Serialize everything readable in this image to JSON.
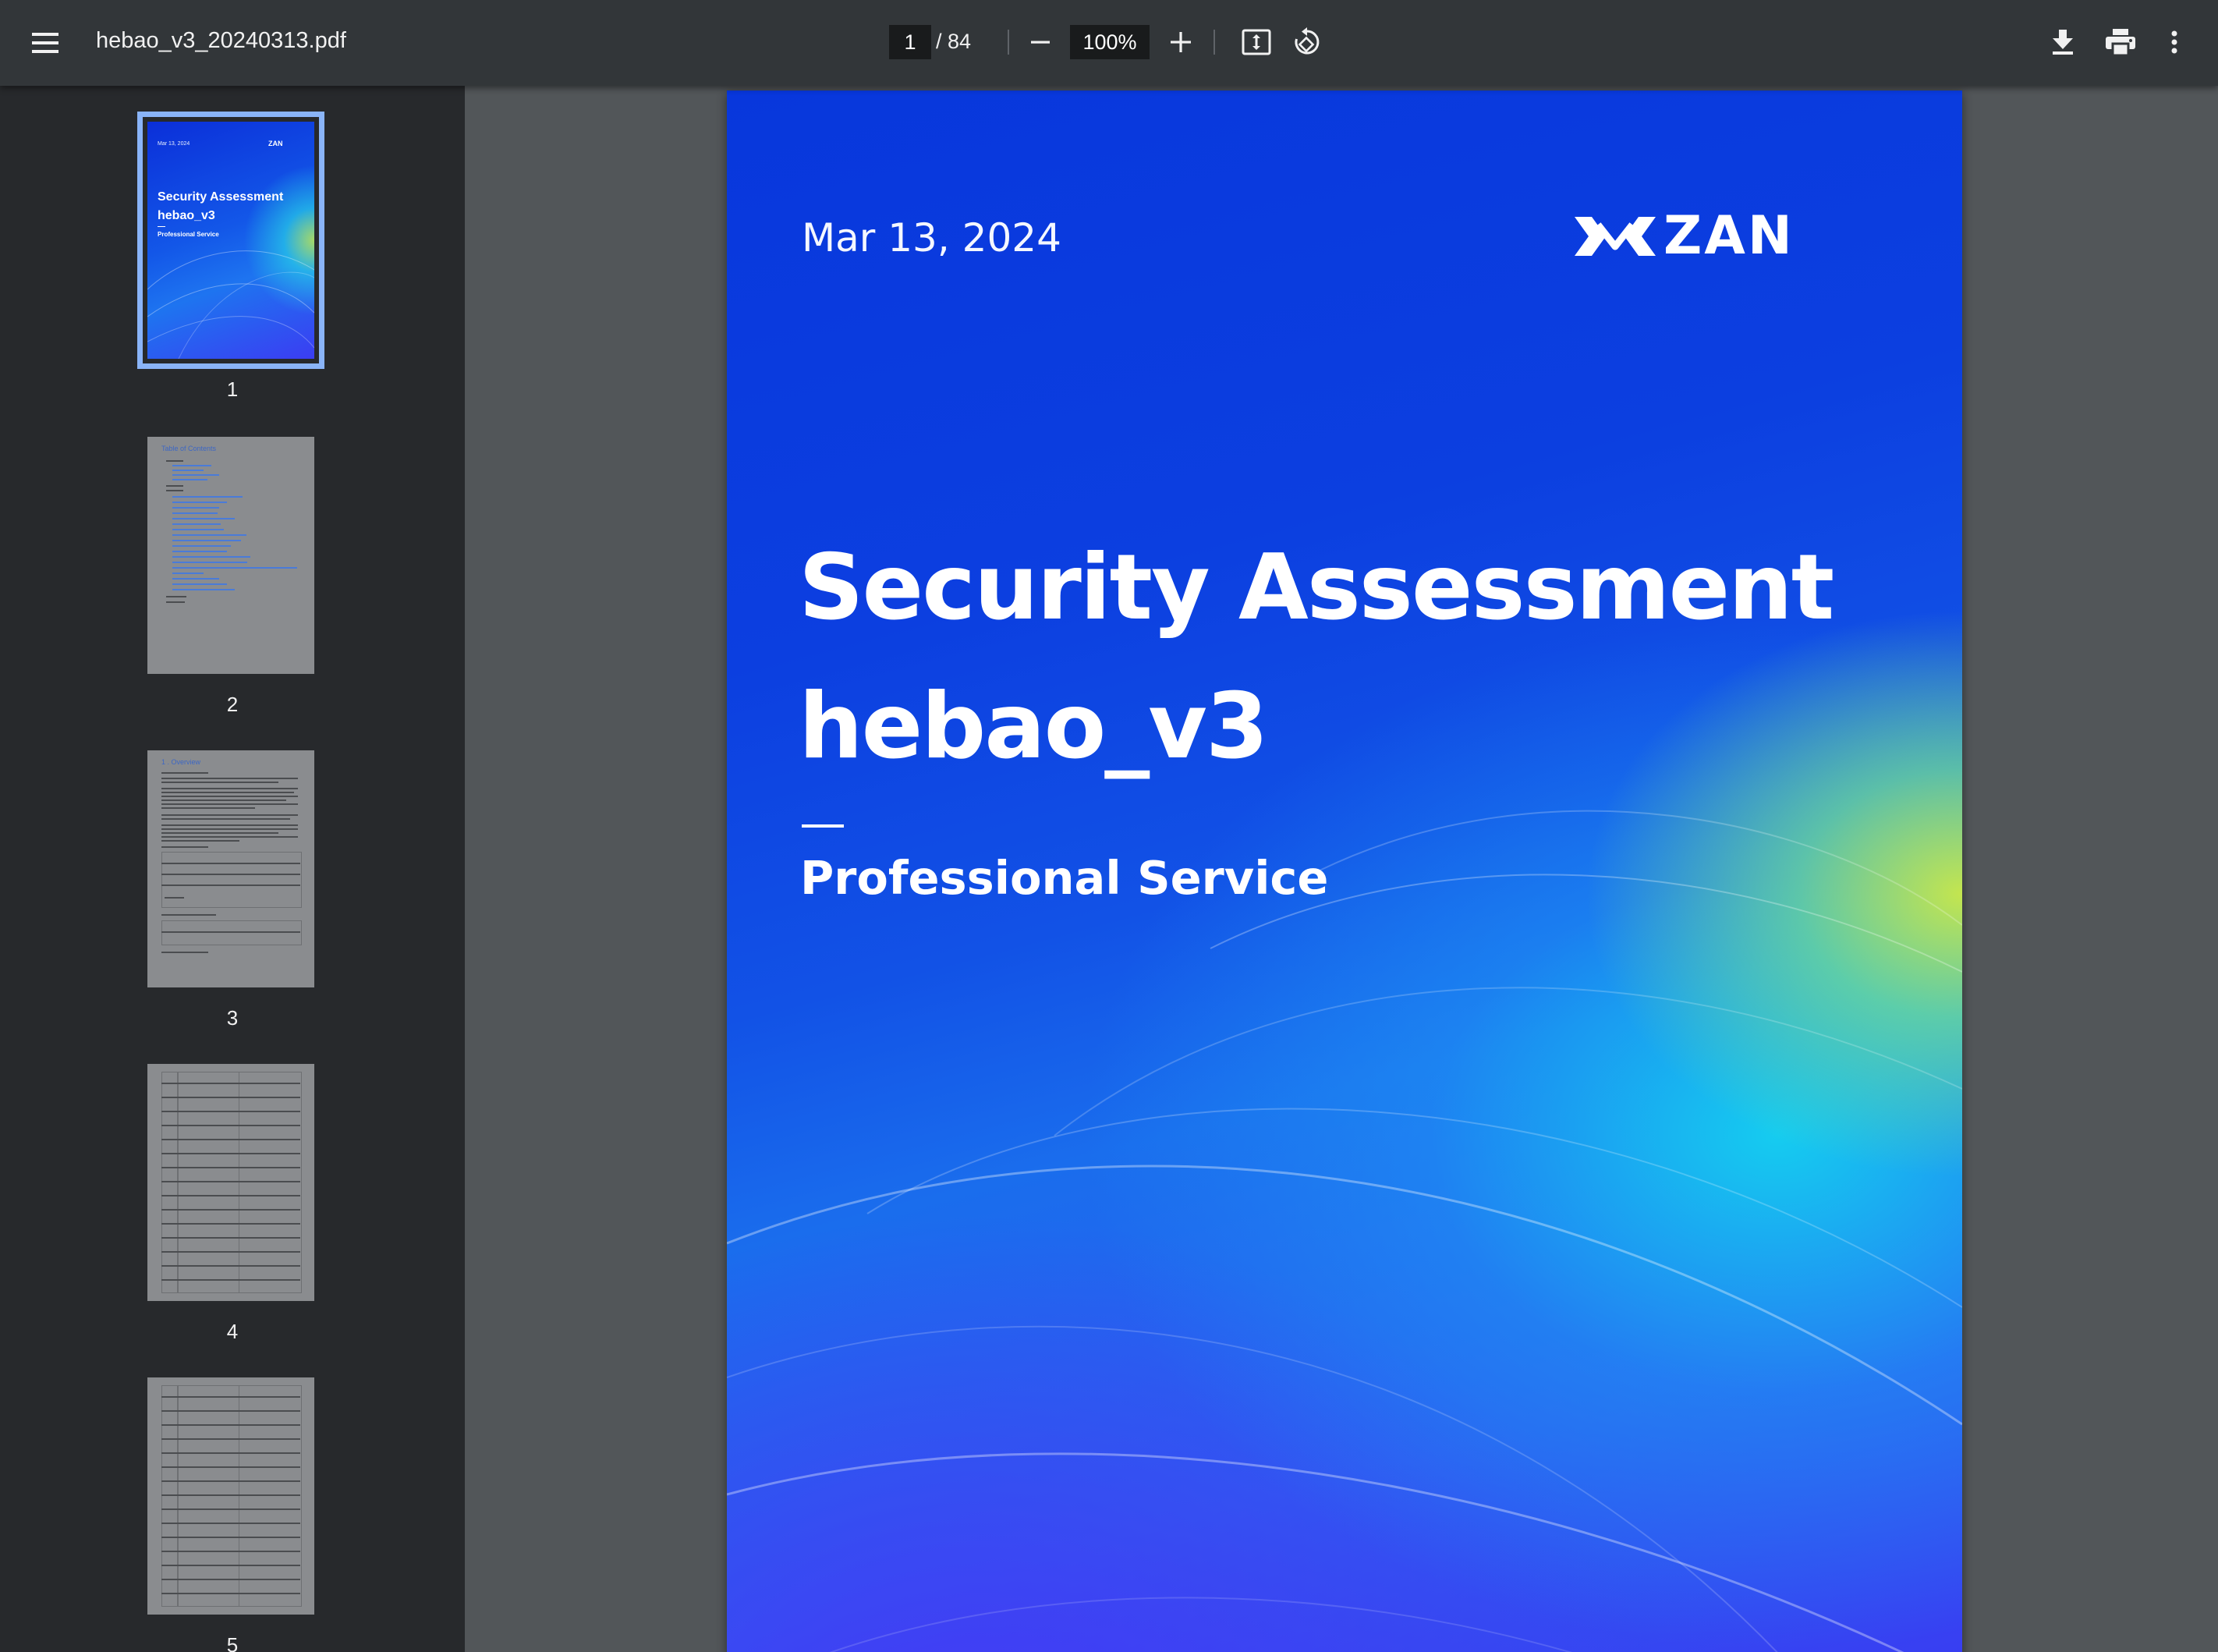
{
  "toolbar": {
    "file_name": "hebao_v3_20240313.pdf",
    "current_page": "1",
    "page_total": "/ 84",
    "zoom": "100%",
    "icons": [
      "menu-icon",
      "zoom-out-icon",
      "zoom-in-icon",
      "fit-page-icon",
      "rotate-icon",
      "download-icon",
      "print-icon",
      "more-vert-icon"
    ]
  },
  "sidebar": {
    "thumbnails": [
      {
        "label": "1",
        "selected": true
      },
      {
        "label": "2",
        "selected": false
      },
      {
        "label": "3",
        "selected": false
      },
      {
        "label": "4",
        "selected": false
      },
      {
        "label": "5",
        "selected": false
      }
    ],
    "thumb1": {
      "date": "Mar 13, 2024",
      "logo": "ZAN",
      "title_line1": "Security Assessment",
      "title_line2": "hebao_v3",
      "subtitle": "Professional Service"
    },
    "thumb2": {
      "heading": "Table of Contents"
    },
    "thumb3": {
      "heading": "1 . Overview"
    }
  },
  "cover": {
    "date": "Mar 13, 2024",
    "logo_text": "ZAN",
    "title_line1": "Security Assessment",
    "title_line2": "hebao_v3",
    "subtitle": "Professional Service",
    "colors": {
      "deep_blue": "#0837dc",
      "cyan": "#1ed8ec",
      "lime": "#cdeb46",
      "violet": "#3a3af2"
    }
  },
  "colors": {
    "toolbar_bg": "#323639",
    "sidebar_bg": "#27292c",
    "viewer_bg": "#525659",
    "selection": "#8ab4f8"
  }
}
